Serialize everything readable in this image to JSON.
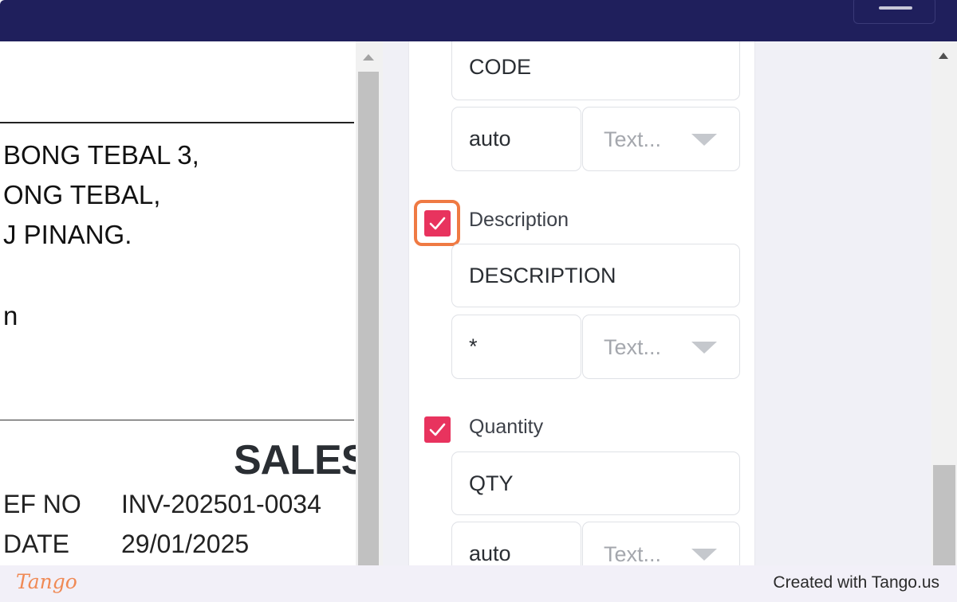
{
  "header": {
    "menu_icon": "hamburger-icon"
  },
  "preview": {
    "address_lines": [
      "BONG TEBAL 3,",
      "ONG TEBAL,",
      "J PINANG.",
      "n"
    ],
    "doc_title": "SALES",
    "ref_label": "EF NO",
    "ref_value": "INV-202501-0034",
    "date_label": "DATE",
    "date_value": "29/01/2025"
  },
  "panel": {
    "code": {
      "header_value": "CODE",
      "width_value": "auto",
      "align_placeholder": "Text..."
    },
    "description": {
      "checked": true,
      "label": "Description",
      "header_value": "DESCRIPTION",
      "width_value": "*",
      "align_placeholder": "Text..."
    },
    "quantity": {
      "checked": true,
      "label": "Quantity",
      "header_value": "QTY",
      "width_value": "auto",
      "align_placeholder": "Text..."
    }
  },
  "footer": {
    "logo": "Tango",
    "credit": "Created with Tango.us"
  },
  "colors": {
    "topbar": "#1f1f5c",
    "checkbox": "#e8335e",
    "highlight": "#ef7a43",
    "logo": "#f08a55"
  }
}
